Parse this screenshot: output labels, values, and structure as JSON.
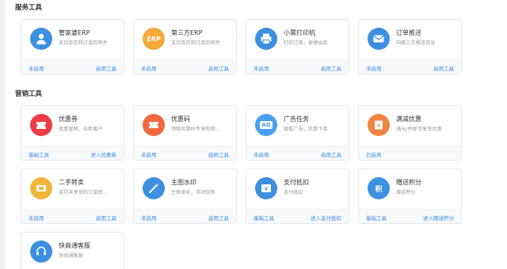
{
  "sections": [
    {
      "title": "服务工具",
      "cards": [
        {
          "name": "管家婆ERP",
          "desc": "支持库存和订单的同步",
          "status": "未启用",
          "action": "启用工具",
          "icon": "user-icon",
          "color": "#3d8fe0"
        },
        {
          "name": "第三方ERP",
          "desc": "支持库存和订单的同步",
          "status": "未启用",
          "action": "启用工具",
          "icon": "erp-icon",
          "icon_text": "ERP",
          "color": "#f5a93a"
        },
        {
          "name": "小票打印机",
          "desc": "打印订单，便捷出单",
          "status": "未启用",
          "action": "启用工具",
          "icon": "printer-icon",
          "color": "#3d8fe0"
        },
        {
          "name": "订单推送",
          "desc": "向第三方推送信息",
          "status": "未启用",
          "action": "启用工具",
          "icon": "mail-icon",
          "color": "#3d8fe0"
        }
      ]
    },
    {
      "title": "营销工具",
      "cards": [
        {
          "name": "优惠券",
          "desc": "优惠营销，拉新客户",
          "status": "基础工具",
          "action": "进入优惠券",
          "icon": "coupon-icon",
          "color": "#ee3b45"
        },
        {
          "name": "优惠码",
          "desc": "领取优惠码专享购物...",
          "status": "未启用",
          "action": "启用工具",
          "icon": "ticket-icon",
          "color": "#f3683f"
        },
        {
          "name": "广告任务",
          "desc": "观看广告，优惠下单",
          "status": "未启用",
          "action": "启用工具",
          "icon": "ad-icon",
          "icon_text": "AD",
          "color": "#4aa0f0"
        },
        {
          "name": "满减优惠",
          "desc": "满元/件即可享受优惠",
          "status": "已启用",
          "action": "",
          "icon": "discount-icon",
          "color": "#f08443"
        },
        {
          "name": "二手转卖",
          "desc": "支持未发货的订单转...",
          "status": "未启用",
          "action": "启用工具",
          "icon": "resale-icon",
          "color": "#f3b63c"
        },
        {
          "name": "主图水印",
          "desc": "主图美化，活动促销",
          "status": "未启用",
          "action": "启用工具",
          "icon": "wand-icon",
          "color": "#3d8fe0"
        },
        {
          "name": "支付抵扣",
          "desc": "支付抵扣",
          "status": "基础工具",
          "action": "进入支付抵扣",
          "icon": "yen-icon",
          "color": "#3d8fe0"
        },
        {
          "name": "赠送积分",
          "desc": "赠送积分",
          "status": "基础工具",
          "action": "进入赠送积分",
          "icon": "points-icon",
          "icon_text": "积",
          "color": "#3d8fe0"
        },
        {
          "name": "快商通客服",
          "desc": "快商通客服",
          "status": "",
          "action": "",
          "icon": "headset-icon",
          "color": "#3d8fe0"
        }
      ]
    }
  ]
}
